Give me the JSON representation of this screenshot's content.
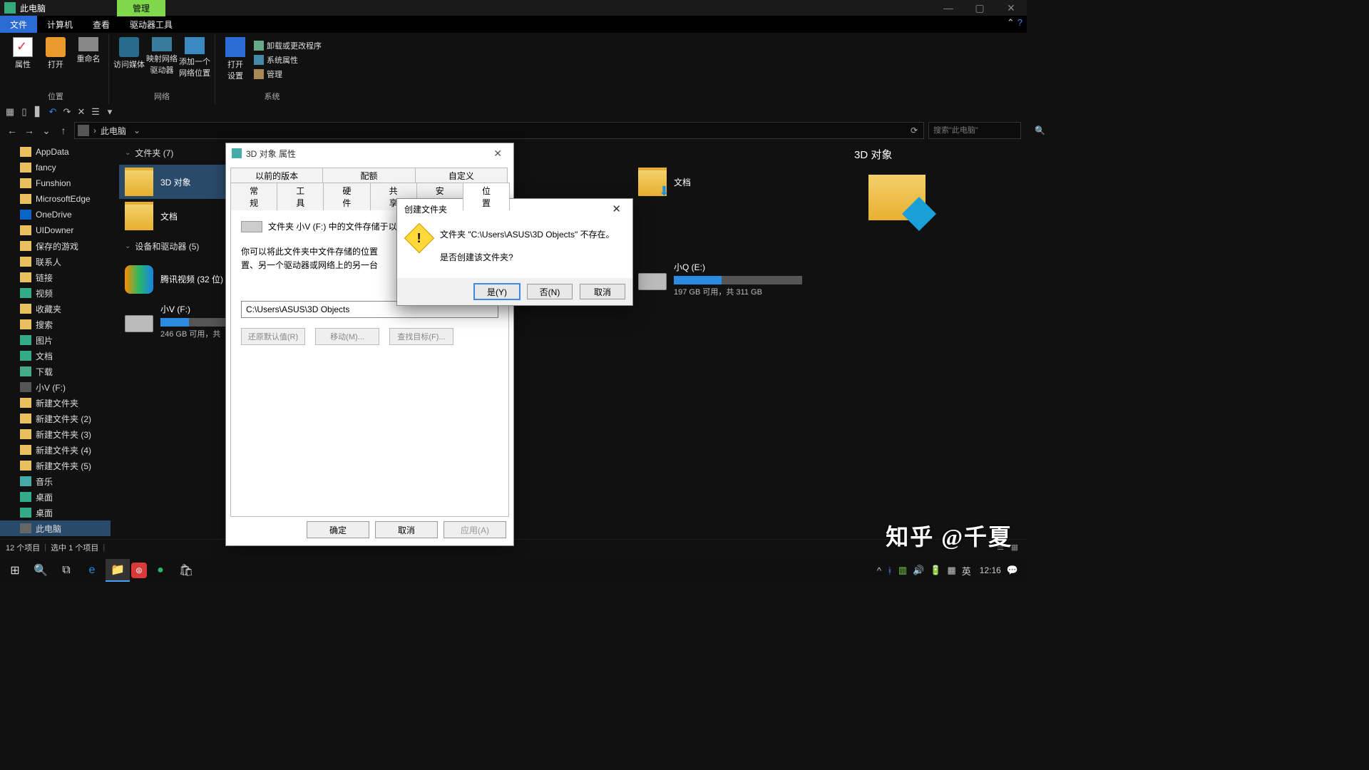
{
  "titlebar": {
    "title": "此电脑",
    "context_tab": "管理"
  },
  "menu_tabs": {
    "file": "文件",
    "computer": "计算机",
    "view": "查看",
    "drive_tools": "驱动器工具"
  },
  "ribbon": {
    "group_location": {
      "label": "位置",
      "props": "属性",
      "open": "打开",
      "rename": "重命名"
    },
    "group_network": {
      "label": "网络",
      "access_media": "访问媒体",
      "map_drive": "映射网络\n驱动器",
      "add_net": "添加一个\n网络位置"
    },
    "group_system": {
      "label": "系统",
      "open_settings": "打开\n设置",
      "uninstall": "卸载或更改程序",
      "sys_props": "系统属性",
      "manage": "管理"
    }
  },
  "nav": {
    "crumb": "此电脑",
    "search_placeholder": "搜索\"此电脑\""
  },
  "tree": [
    {
      "label": "AppData"
    },
    {
      "label": "fancy"
    },
    {
      "label": "Funshion"
    },
    {
      "label": "MicrosoftEdge"
    },
    {
      "label": "OneDrive",
      "cls": "od"
    },
    {
      "label": "UIDowner"
    },
    {
      "label": "保存的游戏"
    },
    {
      "label": "联系人"
    },
    {
      "label": "链接"
    },
    {
      "label": "视频",
      "cls": "img"
    },
    {
      "label": "收藏夹"
    },
    {
      "label": "搜索"
    },
    {
      "label": "图片",
      "cls": "img"
    },
    {
      "label": "文档",
      "cls": "img"
    },
    {
      "label": "下载",
      "cls": "dl"
    },
    {
      "label": "小V (F:)",
      "cls": "drv"
    },
    {
      "label": "新建文件夹"
    },
    {
      "label": "新建文件夹 (2)"
    },
    {
      "label": "新建文件夹 (3)"
    },
    {
      "label": "新建文件夹 (4)"
    },
    {
      "label": "新建文件夹 (5)"
    },
    {
      "label": "音乐",
      "cls": "music"
    },
    {
      "label": "桌面",
      "cls": "img"
    },
    {
      "label": "桌面",
      "cls": "img"
    },
    {
      "label": "此电脑",
      "cls": "pc",
      "selected": true
    }
  ],
  "content": {
    "folders_header": "文件夹 (7)",
    "folders": [
      {
        "name": "3D 对象",
        "selected": true
      },
      {
        "name": "文档"
      }
    ],
    "folders_right": [
      {
        "name": "文档"
      }
    ],
    "drives_header": "设备和驱动器 (5)",
    "drive_left": {
      "name": "腾讯视频 (32 位)"
    },
    "drive_f": {
      "name": "小V (F:)",
      "bar_pct": 22,
      "sub": "246 GB 可用，共 "
    },
    "drive_e": {
      "name": "小Q  (E:)",
      "bar_pct": 37,
      "sub": "197 GB 可用，共 311 GB"
    }
  },
  "preview": {
    "title": "3D 对象"
  },
  "status": {
    "left1": "12 个项目",
    "left2": "选中 1 个项目"
  },
  "prop": {
    "title": "3D 对象 属性",
    "tabs_row1": [
      "以前的版本",
      "配额",
      "自定义"
    ],
    "tabs_row2": [
      "常规",
      "工具",
      "硬件",
      "共享",
      "安全",
      "位置"
    ],
    "active_tab": "位置",
    "line1": "文件夹 小V (F:) 中的文件存储于以下",
    "desc": "你可以将此文件夹中文件存储的位置\n置、另一个驱动器或网络上的另一台",
    "path": "C:\\Users\\ASUS\\3D Objects",
    "btn_restore": "还原默认值(R)",
    "btn_move": "移动(M)...",
    "btn_find": "查找目标(F)...",
    "ok": "确定",
    "cancel": "取消",
    "apply": "应用(A)"
  },
  "msg": {
    "title": "创建文件夹",
    "line1": "文件夹 \"C:\\Users\\ASUS\\3D Objects\" 不存在。",
    "line2": "是否创建该文件夹?",
    "yes": "是(Y)",
    "no": "否(N)",
    "cancel": "取消"
  },
  "taskbar": {
    "tray_ime": "英",
    "clock": "12:16"
  },
  "watermark": "知乎 @千夏"
}
